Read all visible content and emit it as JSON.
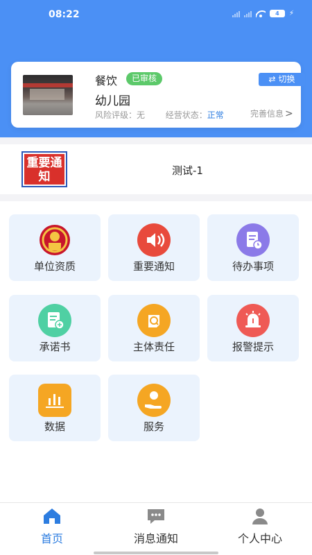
{
  "status_bar": {
    "time": "08:22",
    "battery": "4"
  },
  "store_card": {
    "category": "餐饮",
    "audit_badge": "已审核",
    "switch_label": "切换",
    "name": "幼儿园",
    "risk_label": "风险评级：",
    "risk_value": "无",
    "operation_label": "经营状态：",
    "operation_value": "正常",
    "perfect_info": "完善信息"
  },
  "notice": {
    "logo_text": "重要通知",
    "title": "测试-1"
  },
  "grid": [
    {
      "label": "单位资质",
      "icon": "national-emblem-icon",
      "color": "#c8162c"
    },
    {
      "label": "重要通知",
      "icon": "speaker-icon",
      "color": "#e84a3c"
    },
    {
      "label": "待办事项",
      "icon": "todo-list-icon",
      "color": "#8b7ae8"
    },
    {
      "label": "承诺书",
      "icon": "commitment-doc-icon",
      "color": "#4fd0a3"
    },
    {
      "label": "主体责任",
      "icon": "responsibility-icon",
      "color": "#f5a623"
    },
    {
      "label": "报警提示",
      "icon": "alarm-icon",
      "color": "#ef5a55"
    },
    {
      "label": "数据",
      "icon": "data-chart-icon",
      "color": "#f5a623"
    },
    {
      "label": "服务",
      "icon": "service-hand-icon",
      "color": "#f5a623"
    }
  ],
  "bottom_nav": [
    {
      "label": "首页",
      "icon": "home-icon",
      "active": true
    },
    {
      "label": "消息通知",
      "icon": "message-icon",
      "active": false
    },
    {
      "label": "个人中心",
      "icon": "user-icon",
      "active": false
    }
  ],
  "colors": {
    "primary": "#4b90f5",
    "badge_green": "#5cc96a",
    "tile_bg": "#ebf3fd",
    "active_nav": "#2d7de0"
  }
}
